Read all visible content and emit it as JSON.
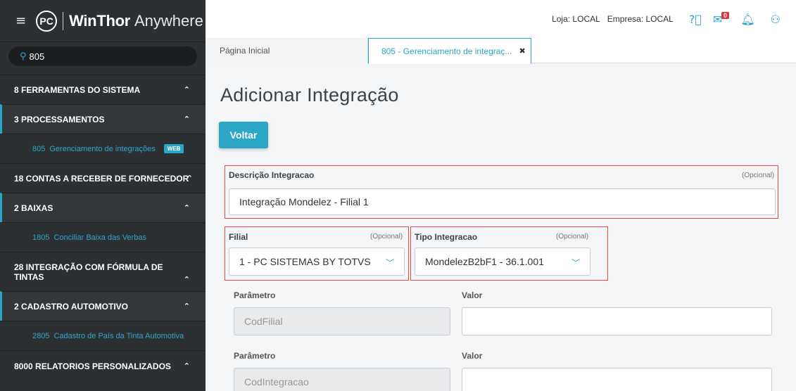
{
  "brand": {
    "logo": "PC",
    "name": "WinThor",
    "sub": "Anywhere"
  },
  "search": {
    "icon": "search-icon",
    "value": "805"
  },
  "sidebar": {
    "items": [
      {
        "label": "8  FERRAMENTAS DO SISTEMA",
        "level": 1
      },
      {
        "label": "3  PROCESSAMENTOS",
        "level": 2
      },
      {
        "code": "805",
        "label": "Gerenciamento de integrações",
        "badge": "WEB",
        "level": 3
      },
      {
        "label": "18  CONTAS A RECEBER DE FORNECEDOR",
        "level": 1
      },
      {
        "label": "2  BAIXAS",
        "level": 2
      },
      {
        "code": "1805",
        "label": "Conciliar Baixa das Verbas",
        "level": 3
      },
      {
        "label": "28  INTEGRAÇÃO COM FÓRMULA DE TINTAS",
        "level": 1
      },
      {
        "label": "2  CADASTRO AUTOMOTIVO",
        "level": 2
      },
      {
        "code": "2805",
        "label": "Cadastro de País da Tinta Automotiva",
        "level": 3
      },
      {
        "label": "8000  RELATORIOS PERSONALIZADOS",
        "level": 1
      }
    ]
  },
  "topbar": {
    "loja": "Loja: LOCAL",
    "empresa": "Empresa: LOCAL",
    "mail_count": "0"
  },
  "tabs": [
    {
      "label": "Página Inicial"
    },
    {
      "label": "805 - Gerenciamento de integraç...",
      "close": "✖"
    }
  ],
  "page": {
    "title": "Adicionar Integração",
    "back_label": "Voltar",
    "descricao": {
      "label": "Descrição Integracao",
      "optional": "(Opcional)",
      "value": "Integração Mondelez - Filial 1"
    },
    "filial": {
      "label": "Filial",
      "optional": "(Opcional)",
      "value": "1 - PC SISTEMAS BY TOTVS"
    },
    "tipo": {
      "label": "Tipo Integracao",
      "optional": "(Opcional)",
      "value": "MondelezB2bF1 - 36.1.001"
    },
    "params": [
      {
        "param_label": "Parâmetro",
        "param_value": "CodFilial",
        "valor_label": "Valor",
        "valor": ""
      },
      {
        "param_label": "Parâmetro",
        "param_value": "CodIntegracao",
        "valor_label": "Valor",
        "valor": ""
      }
    ]
  },
  "colors": {
    "accent": "#2ba7c6",
    "sidebar_bg": "#2d3033",
    "highlight": "#e14b4b"
  }
}
